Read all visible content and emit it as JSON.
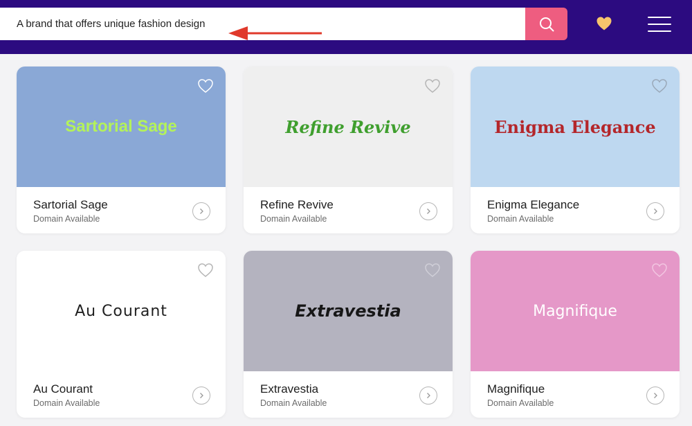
{
  "search": {
    "value": "A brand that offers unique fashion design"
  },
  "colors": {
    "header": "#2c0b80",
    "search_button": "#ee5d80",
    "favorites_heart": "#f7c46c",
    "arrow": "#e0392b"
  },
  "icons": {
    "search": "search-icon",
    "favorites": "heart-icon",
    "menu": "hamburger-menu-icon",
    "card_favorite": "heart-outline-icon",
    "card_open": "chevron-right-circle-icon"
  },
  "cards": [
    {
      "logo": "Sartorial Sage",
      "name": "Sartorial Sage",
      "status": "Domain Available",
      "bg": "#8aa8d6",
      "logo_color": "#b4f25a"
    },
    {
      "logo": "Refine Revive",
      "name": "Refine Revive",
      "status": "Domain Available",
      "bg": "#efefef",
      "logo_color": "#3f9f2e"
    },
    {
      "logo": "Enigma Elegance",
      "name": "Enigma Elegance",
      "status": "Domain Available",
      "bg": "#bed8f0",
      "logo_color": "#b4262a"
    },
    {
      "logo": "Au Courant",
      "name": "Au Courant",
      "status": "Domain Available",
      "bg": "#ffffff",
      "logo_color": "#1f1f1f"
    },
    {
      "logo": "Extravestia",
      "name": "Extravestia",
      "status": "Domain Available",
      "bg": "#b4b3bf",
      "logo_color": "#171717"
    },
    {
      "logo": "Magnifique",
      "name": "Magnifique",
      "status": "Domain Available",
      "bg": "#e598c8",
      "logo_color": "#ffffff"
    }
  ]
}
